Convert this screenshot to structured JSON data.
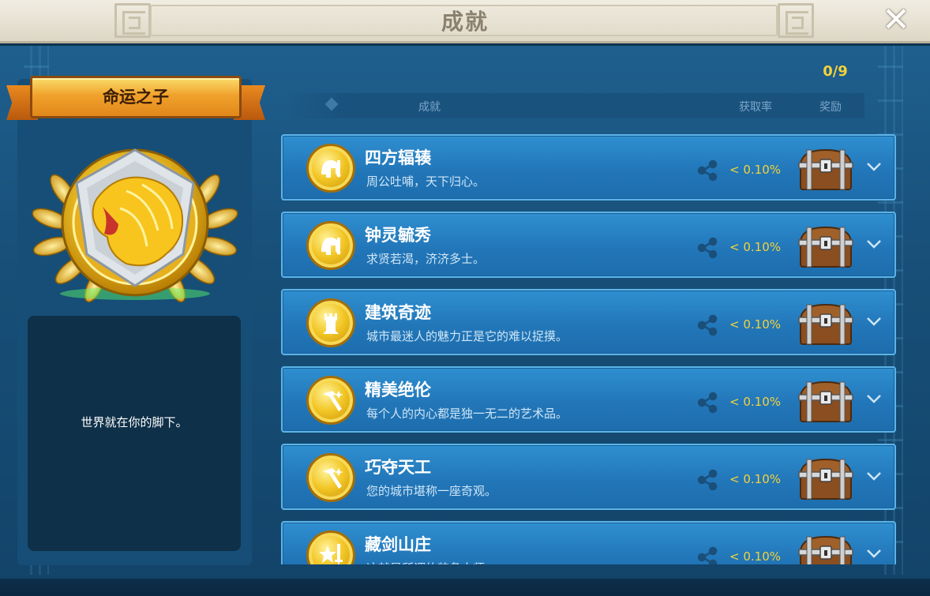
{
  "window": {
    "title": "成就",
    "close_symbol": "✕"
  },
  "left": {
    "ribbon_title": "命运之子",
    "badge_icon": "golden-lion-shield-laurel",
    "description": "世界就在你的脚下。"
  },
  "list": {
    "counter": "0/9",
    "headers": {
      "achievement": "成就",
      "rate": "获取率",
      "reward": "奖励"
    },
    "rows": [
      {
        "name": "四方辐辏",
        "sub": "周公吐哺，天下归心。",
        "rate": "< 0.10%",
        "icon": "helmet-icon"
      },
      {
        "name": "钟灵毓秀",
        "sub": "求贤若渴，济济多士。",
        "rate": "< 0.10%",
        "icon": "helmet-icon"
      },
      {
        "name": "建筑奇迹",
        "sub": "城市最迷人的魅力正是它的难以捉摸。",
        "rate": "< 0.10%",
        "icon": "tower-icon"
      },
      {
        "name": "精美绝伦",
        "sub": "每个人的内心都是独一无二的艺术品。",
        "rate": "< 0.10%",
        "icon": "hammer-icon"
      },
      {
        "name": "巧夺天工",
        "sub": "您的城市堪称一座奇观。",
        "rate": "< 0.10%",
        "icon": "hammer-icon"
      },
      {
        "name": "藏剑山庄",
        "sub": "这就是所谓的装备大师",
        "rate": "< 0.10%",
        "icon": "star-sword-icon"
      }
    ]
  },
  "colors": {
    "accent_gold": "#f4d23a",
    "row_blue": "#2277b9",
    "panel_dark": "#0f3049"
  }
}
